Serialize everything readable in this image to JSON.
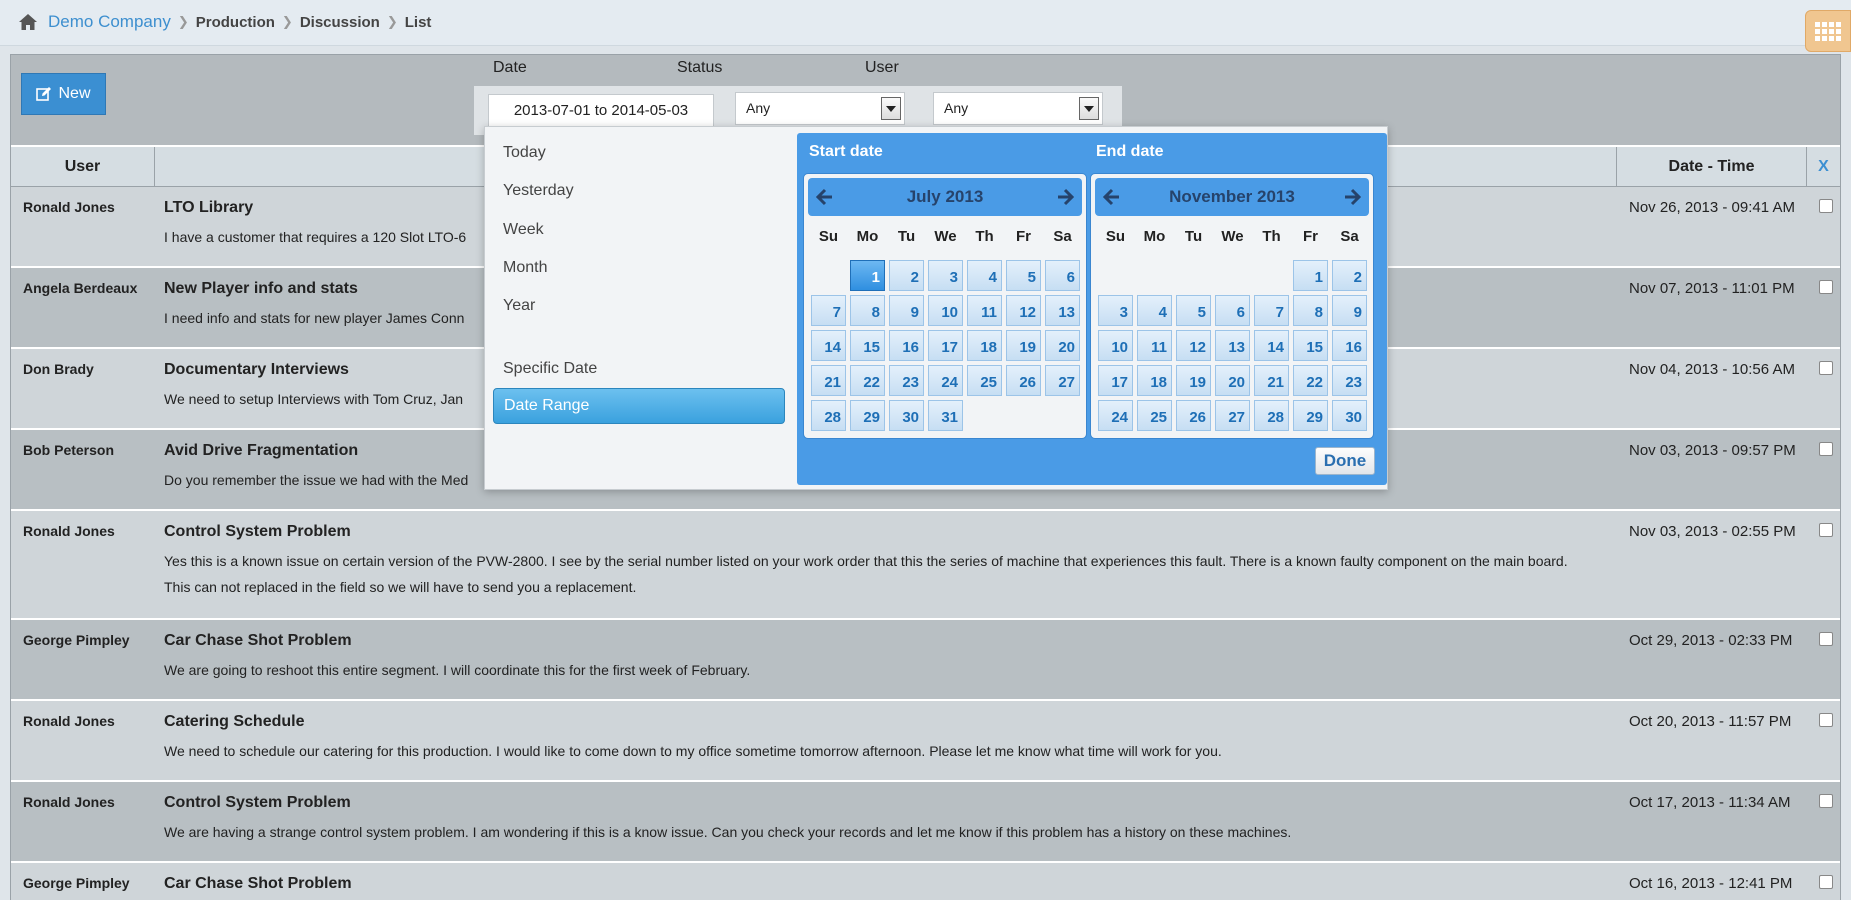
{
  "breadcrumb": {
    "company": "Demo Company",
    "items": [
      "Production",
      "Discussion",
      "List"
    ]
  },
  "toolbar": {
    "new_label": "New"
  },
  "filters": {
    "date_label": "Date",
    "status_label": "Status",
    "user_label": "User",
    "date_value": "2013-07-01 to 2014-05-03",
    "status_value": "Any",
    "user_value": "Any"
  },
  "table": {
    "headers": {
      "user": "User",
      "date_time": "Date - Time",
      "clear": "X"
    },
    "rows": [
      {
        "user": "Ronald Jones",
        "title": "LTO Library",
        "body": "I have a customer that requires a 120 Slot LTO-6",
        "datetime": "Nov 26, 2013 - 09:41 AM"
      },
      {
        "user": "Angela Berdeaux",
        "title": "New Player info and stats",
        "body": "I need info and stats for new player James Conn",
        "datetime": "Nov 07, 2013 - 11:01 PM"
      },
      {
        "user": "Don Brady",
        "title": "Documentary Interviews",
        "body": "We need to setup Interviews with Tom Cruz, Jan",
        "datetime": "Nov 04, 2013 - 10:56 AM"
      },
      {
        "user": "Bob Peterson",
        "title": "Avid Drive Fragmentation",
        "body": "Do you remember the issue we had with the Med",
        "datetime": "Nov 03, 2013 - 09:57 PM"
      },
      {
        "user": "Ronald Jones",
        "title": "Control System Problem",
        "body": "Yes this is a known issue on certain version of the PVW-2800. I see by the serial number listed on your work order that this the series of machine that experiences this fault. There is a known faulty component on the main board. This can not replaced in the field so we will have to send you a replacement.",
        "datetime": "Nov 03, 2013 - 02:55 PM"
      },
      {
        "user": "George Pimpley",
        "title": "Car Chase Shot Problem",
        "body": "We are going to reshoot this entire segment. I will coordinate this for the first week of February.",
        "datetime": "Oct 29, 2013 - 02:33 PM"
      },
      {
        "user": "Ronald Jones",
        "title": "Catering Schedule",
        "body": "We need to schedule our catering for this production. I would like to come down to my office sometime tomorrow afternoon. Please let me know what time will work for you.",
        "datetime": "Oct 20, 2013 - 11:57 PM"
      },
      {
        "user": "Ronald Jones",
        "title": "Control System Problem",
        "body": "We are having a strange control system problem. I am wondering if this is a know issue. Can you check your records and let me know if this problem has a history on these machines.",
        "datetime": "Oct 17, 2013 - 11:34 AM"
      },
      {
        "user": "George Pimpley",
        "title": "Car Chase Shot Problem",
        "body": "",
        "datetime": "Oct 16, 2013 - 12:41 PM"
      }
    ]
  },
  "date_picker": {
    "presets": [
      "Today",
      "Yesterday",
      "Week",
      "Month",
      "Year",
      "Specific Date",
      "Date Range"
    ],
    "active_preset": "Date Range",
    "start_label": "Start date",
    "end_label": "End date",
    "weekdays": [
      "Su",
      "Mo",
      "Tu",
      "We",
      "Th",
      "Fr",
      "Sa"
    ],
    "start_calendar": {
      "month": "July 2013",
      "first_weekday": 1,
      "days": 31,
      "selected": 1
    },
    "end_calendar": {
      "month": "November 2013",
      "first_weekday": 5,
      "days": 30,
      "selected": null
    },
    "done_label": "Done"
  }
}
